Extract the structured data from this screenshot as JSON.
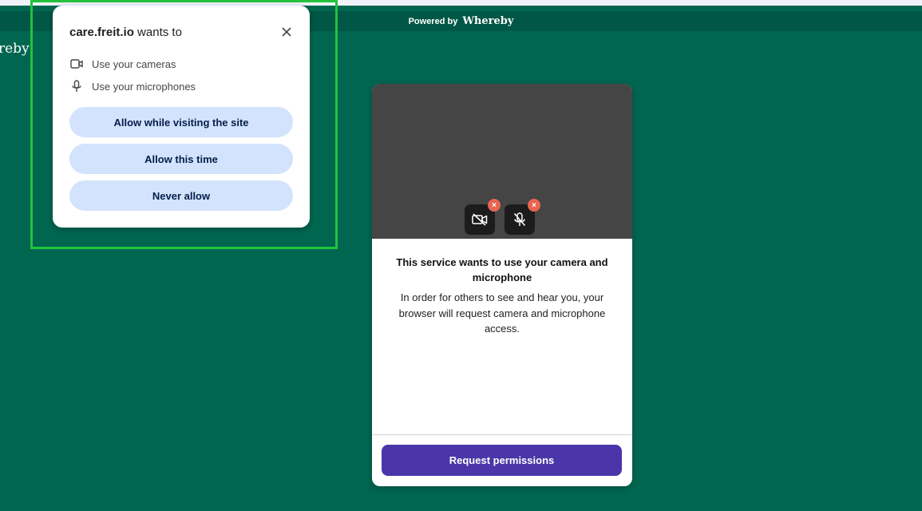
{
  "header": {
    "powered_by": "Powered by",
    "brand": "Whereby",
    "corner_logo": "reby"
  },
  "permission_popup": {
    "origin": "care.freit.io",
    "title_suffix": "wants to",
    "permissions": [
      {
        "label": "Use your cameras",
        "icon": "camera-icon"
      },
      {
        "label": "Use your microphones",
        "icon": "microphone-icon"
      }
    ],
    "buttons": {
      "allow_always": "Allow while visiting the site",
      "allow_once": "Allow this time",
      "deny": "Never allow"
    },
    "close_icon": "close-icon"
  },
  "card": {
    "camera_status": "camera-off-icon",
    "mic_status": "microphone-off-icon",
    "badge_glyph": "×",
    "heading": "This service wants to use your camera and microphone",
    "body": "In order for others to see and hear you, your browser will request camera and microphone access.",
    "button": "Request permissions"
  },
  "colors": {
    "page_background": "#006650",
    "header_bar": "#005745",
    "highlight_border": "#22c33c",
    "popup_button": "#d3e3fd",
    "primary_button": "#4a36a8",
    "error_badge": "#ea6551"
  }
}
